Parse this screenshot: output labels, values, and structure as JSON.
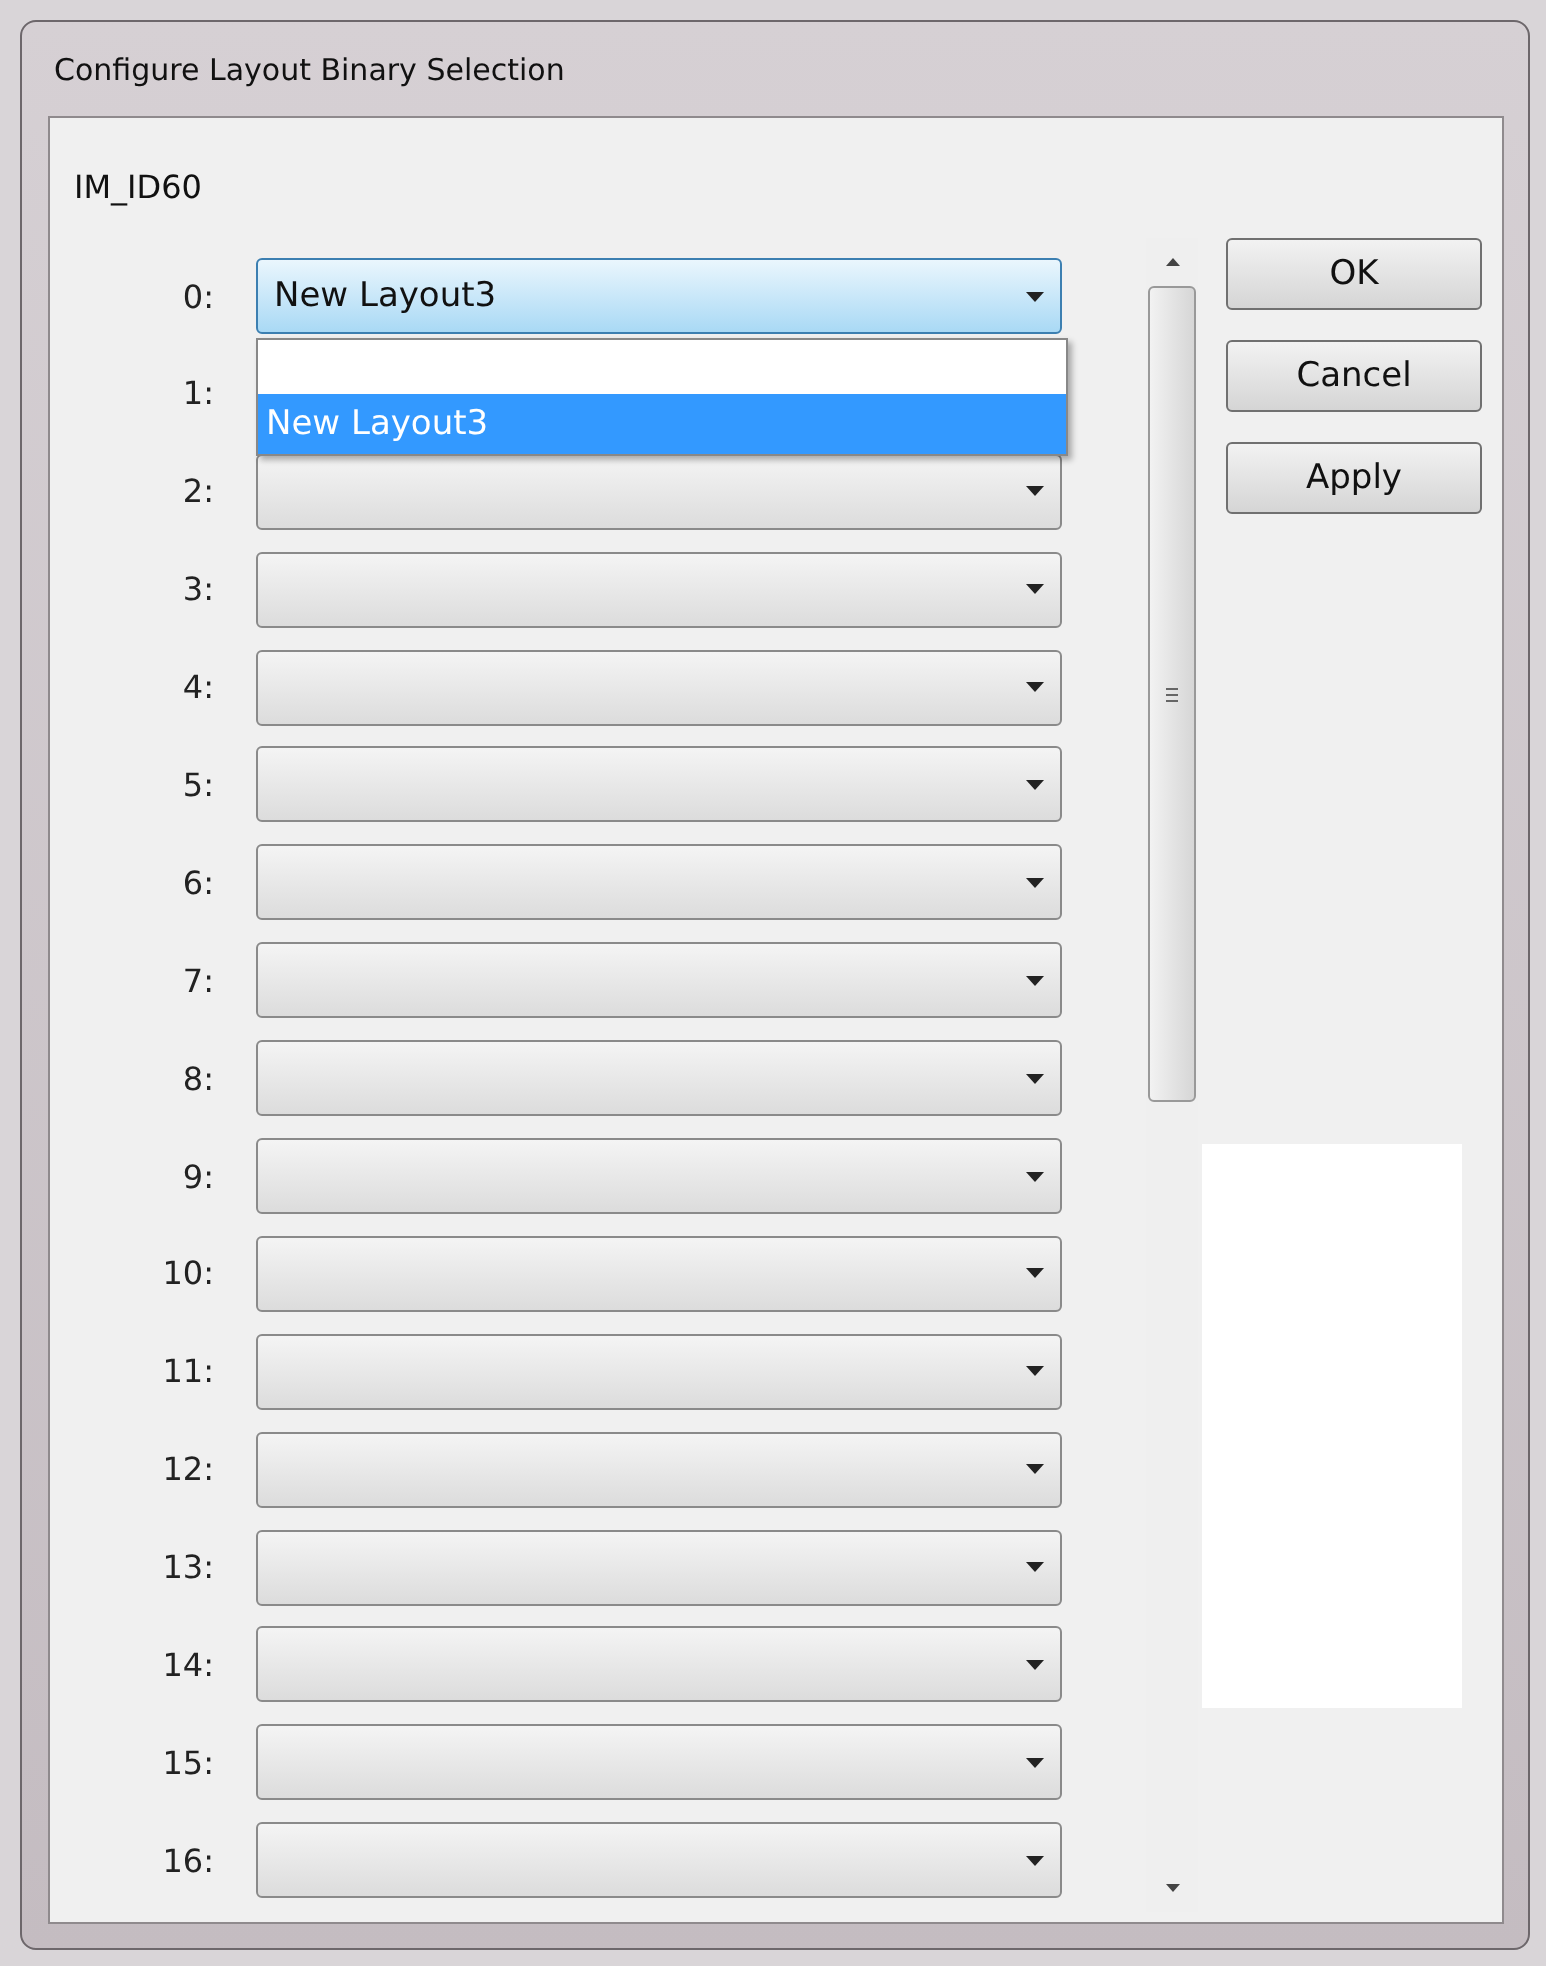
{
  "window": {
    "title": "Configure Layout Binary Selection"
  },
  "group_label": "IM_ID60",
  "rows": [
    {
      "label": "0:",
      "value": "New Layout3",
      "focused": true,
      "options": [
        {
          "selected": false
        },
        {
          "text": "New Layout3",
          "selected": true
        }
      ]
    },
    {
      "label": "1:"
    },
    {
      "label": "2:",
      "focused": false
    },
    {
      "label": "3:",
      "focused": false
    },
    {
      "label": "4:",
      "focused": false
    },
    {
      "label": "5:",
      "focused": false
    },
    {
      "label": "6:",
      "focused": false
    },
    {
      "label": "7:",
      "focused": false
    },
    {
      "label": "8:",
      "focused": false
    },
    {
      "label": "9:",
      "focused": false
    },
    {
      "label": "10:",
      "focused": false
    },
    {
      "label": "11:",
      "focused": false
    },
    {
      "label": "12:",
      "focused": false
    },
    {
      "label": "13:",
      "focused": false
    },
    {
      "label": "14:",
      "focused": false
    },
    {
      "label": "15:",
      "focused": false
    },
    {
      "label": "16:",
      "focused": false
    }
  ],
  "buttons": [
    "OK",
    "Cancel",
    "Apply"
  ]
}
